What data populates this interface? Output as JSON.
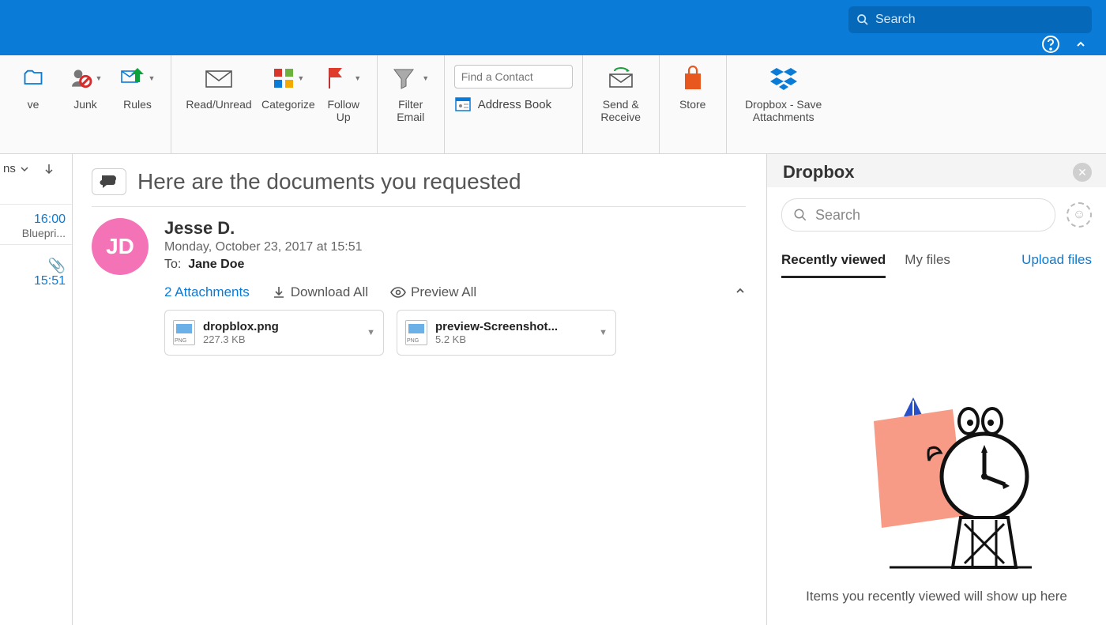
{
  "header": {
    "search_placeholder": "Search"
  },
  "ribbon": {
    "move_label": "ve",
    "junk_label": "Junk",
    "rules_label": "Rules",
    "readunread_label": "Read/Unread",
    "categorize_label": "Categorize",
    "followup_label": "Follow\nUp",
    "filter_label": "Filter\nEmail",
    "find_contact_placeholder": "Find a Contact",
    "address_book_label": "Address Book",
    "sendreceive_label": "Send &\nReceive",
    "store_label": "Store",
    "dropbox_label": "Dropbox - Save\nAttachments"
  },
  "inbox_sliver": {
    "folder_label": "ns",
    "items": [
      {
        "time": "16:00",
        "subject": "Bluepri..."
      },
      {
        "time": "15:51",
        "subject": ""
      }
    ]
  },
  "message": {
    "subject": "Here are the documents you requested",
    "sender_name": "Jesse D.",
    "sender_initials": "JD",
    "date_line": "Monday, October 23, 2017 at 15:51",
    "to_label": "To:",
    "to_name": "Jane Doe",
    "attachments_link": "2 Attachments",
    "download_all": "Download All",
    "preview_all": "Preview All",
    "attachments": [
      {
        "filename": "dropblox.png",
        "size": "227.3 KB"
      },
      {
        "filename": "preview-Screenshot...",
        "size": "5.2 KB"
      }
    ]
  },
  "dropbox": {
    "title": "Dropbox",
    "search_placeholder": "Search",
    "tabs": {
      "recent": "Recently viewed",
      "myfiles": "My files",
      "upload": "Upload files"
    },
    "empty_text": "Items you recently viewed will show up here"
  }
}
